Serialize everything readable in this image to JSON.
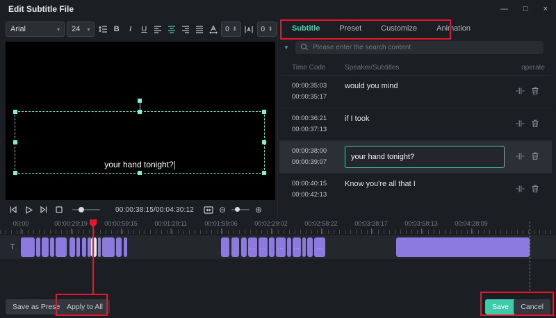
{
  "window": {
    "title": "Edit Subtitle File"
  },
  "icons": {
    "minimize": "—",
    "maximize": "□",
    "close": "×",
    "chevron_down": "▾",
    "collapse_chevron": "▾",
    "zoom_out": "⊖",
    "zoom_in": "⊕"
  },
  "toolbar": {
    "font": "Arial",
    "size": "24",
    "bold": "B",
    "italic": "I",
    "underline": "U",
    "char_spacing_value": "0",
    "line_spacing_value": "0"
  },
  "preview": {
    "subtitle_text": "your hand tonight?",
    "timecode": "00:00:38:15/00:04:30:12"
  },
  "tabs": [
    {
      "label": "Subtitle"
    },
    {
      "label": "Preset"
    },
    {
      "label": "Customize"
    },
    {
      "label": "Animation"
    }
  ],
  "search": {
    "placeholder": "Please enter the search content"
  },
  "subtitle_list": {
    "headers": {
      "time_code": "Time Code",
      "speaker": "Speaker/Subtitles",
      "operate": "operate"
    },
    "rows": [
      {
        "start": "00:00:35:03",
        "end": "00:00:35:17",
        "text": "would you mind"
      },
      {
        "start": "00:00:36:21",
        "end": "00:00:37:13",
        "text": "if I took"
      },
      {
        "start": "00:00:38:00",
        "end": "00:00:39:07",
        "text": "your hand tonight?"
      },
      {
        "start": "00:00:40:15",
        "end": "00:00:42:13",
        "text": "Know you're all that I"
      }
    ]
  },
  "timeline": {
    "track_label": "T",
    "ruler_labels": [
      "00:00",
      "00:00:29:19",
      "00:00:59:15",
      "00:01:29:11",
      "00:01:59:06",
      "00:02:29:02",
      "00:02:58:22",
      "00:03:28:17",
      "00:03:58:13",
      "00:04:28:09"
    ],
    "blocks": [
      {
        "l": 30,
        "w": 20
      },
      {
        "l": 52,
        "w": 6
      },
      {
        "l": 60,
        "w": 10
      },
      {
        "l": 72,
        "w": 6
      },
      {
        "l": 80,
        "w": 16
      },
      {
        "l": 100,
        "w": 8
      },
      {
        "l": 110,
        "w": 5
      },
      {
        "l": 118,
        "w": 6
      },
      {
        "l": 126,
        "w": 5
      },
      {
        "l": 131,
        "w": 8,
        "light": true
      },
      {
        "l": 141,
        "w": 4
      },
      {
        "l": 147,
        "w": 18
      },
      {
        "l": 167,
        "w": 8
      },
      {
        "l": 178,
        "w": 5
      },
      {
        "l": 318,
        "w": 12
      },
      {
        "l": 333,
        "w": 11
      },
      {
        "l": 347,
        "w": 8
      },
      {
        "l": 357,
        "w": 13,
        "label": "..."
      },
      {
        "l": 372,
        "w": 13,
        "label": "..."
      },
      {
        "l": 387,
        "w": 8
      },
      {
        "l": 397,
        "w": 14,
        "label": "..."
      },
      {
        "l": 413,
        "w": 6
      },
      {
        "l": 421,
        "w": 12,
        "label": "..."
      },
      {
        "l": 435,
        "w": 5
      },
      {
        "l": 442,
        "w": 8
      },
      {
        "l": 452,
        "w": 16,
        "label": "..."
      },
      {
        "l": 570,
        "w": 192
      }
    ]
  },
  "footer": {
    "save_as_preset": "Save as Preset",
    "apply_to_all": "Apply to All",
    "save": "Save",
    "cancel": "Cancel"
  },
  "colors": {
    "accent": "#3fcbab",
    "purple": "#8c7ae0",
    "annotation": "#e8152b"
  }
}
